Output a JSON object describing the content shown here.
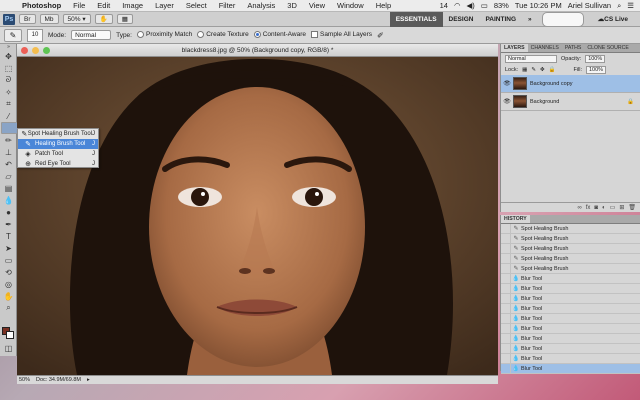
{
  "menubar": {
    "app": "Photoshop",
    "items": [
      "File",
      "Edit",
      "Image",
      "Layer",
      "Select",
      "Filter",
      "Analysis",
      "3D",
      "View",
      "Window",
      "Help"
    ],
    "battery": "14",
    "battery_pct": "83%",
    "clock": "Tue 10:26 PM",
    "user": "Ariel Sullivan"
  },
  "appbar": {
    "logo": "Ps",
    "zoom": "50%",
    "workspaces": [
      "ESSENTIALS",
      "DESIGN",
      "PAINTING",
      "»"
    ],
    "cs_live": "CS Live"
  },
  "options": {
    "brush_size": "10",
    "mode_label": "Mode:",
    "mode_value": "Normal",
    "type_label": "Type:",
    "type_options": [
      "Proximity Match",
      "Create Texture",
      "Content-Aware"
    ],
    "selected_type": "Content-Aware",
    "sample_all": "Sample All Layers"
  },
  "flyout": {
    "items": [
      {
        "label": "Spot Healing Brush Tool",
        "key": "J"
      },
      {
        "label": "Healing Brush Tool",
        "key": "J"
      },
      {
        "label": "Patch Tool",
        "key": "J"
      },
      {
        "label": "Red Eye Tool",
        "key": "J"
      }
    ],
    "selected_index": 1
  },
  "document": {
    "title": "blackdress8.jpg @ 50% (Background copy, RGB/8) *",
    "zoom": "50%",
    "doc_info": "Doc: 34.9M/69.8M"
  },
  "layers_panel": {
    "tabs": [
      "LAYERS",
      "CHANNELS",
      "PATHS",
      "CLONE SOURCE"
    ],
    "blend": "Normal",
    "opacity_label": "Opacity:",
    "opacity": "100%",
    "lock_label": "Lock:",
    "fill_label": "Fill:",
    "fill": "100%",
    "layers": [
      {
        "name": "Background copy",
        "selected": true
      },
      {
        "name": "Background",
        "selected": false
      }
    ],
    "footer_icons": [
      "link-icon",
      "fx-icon",
      "mask-icon",
      "adjustment-icon",
      "folder-icon",
      "new-layer-icon",
      "trash-icon"
    ]
  },
  "history_panel": {
    "tab": "HISTORY",
    "items": [
      "Spot Healing Brush",
      "Spot Healing Brush",
      "Spot Healing Brush",
      "Spot Healing Brush",
      "Spot Healing Brush",
      "Blur Tool",
      "Blur Tool",
      "Blur Tool",
      "Blur Tool",
      "Blur Tool",
      "Blur Tool",
      "Blur Tool",
      "Blur Tool",
      "Blur Tool",
      "Blur Tool"
    ],
    "selected_index": 14
  },
  "colors": {
    "foreground": "#7a3123",
    "background": "#ffffff",
    "accent": "#4a86d8"
  }
}
